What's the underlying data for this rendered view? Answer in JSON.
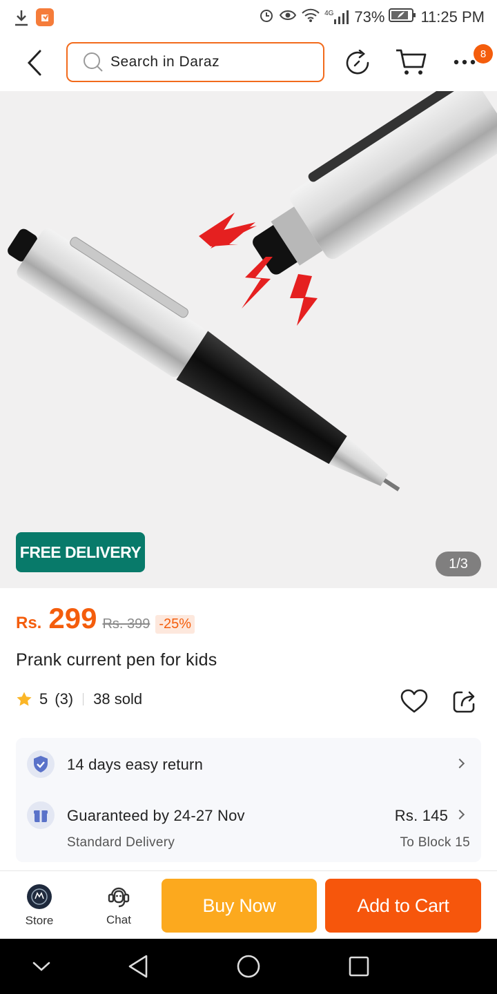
{
  "status_bar": {
    "network": "4G",
    "battery": "73%",
    "time": "11:25 PM"
  },
  "header": {
    "search_placeholder": "Search in Daraz",
    "cart_count": "8"
  },
  "product": {
    "free_delivery_badge": "FREE DELIVERY",
    "image_counter": "1/3",
    "currency": "Rs.",
    "price": "299",
    "old_price": "Rs. 399",
    "discount": "-25%",
    "title": "Prank current pen for kids",
    "rating": "5",
    "rating_count": "(3)",
    "sold": "38 sold"
  },
  "delivery": {
    "return_policy": "14 days easy return",
    "guarantee": "Guaranteed by 24-27 Nov",
    "delivery_type": "Standard Delivery",
    "delivery_fee": "Rs. 145",
    "destination": "To Block 15"
  },
  "actions": {
    "store_label": "Store",
    "chat_label": "Chat",
    "buy_now_label": "Buy Now",
    "add_to_cart_label": "Add to Cart"
  },
  "colors": {
    "brand_orange": "#f45d0c",
    "buy_now": "#fca91e",
    "free_delivery_bg": "#087a6a"
  }
}
